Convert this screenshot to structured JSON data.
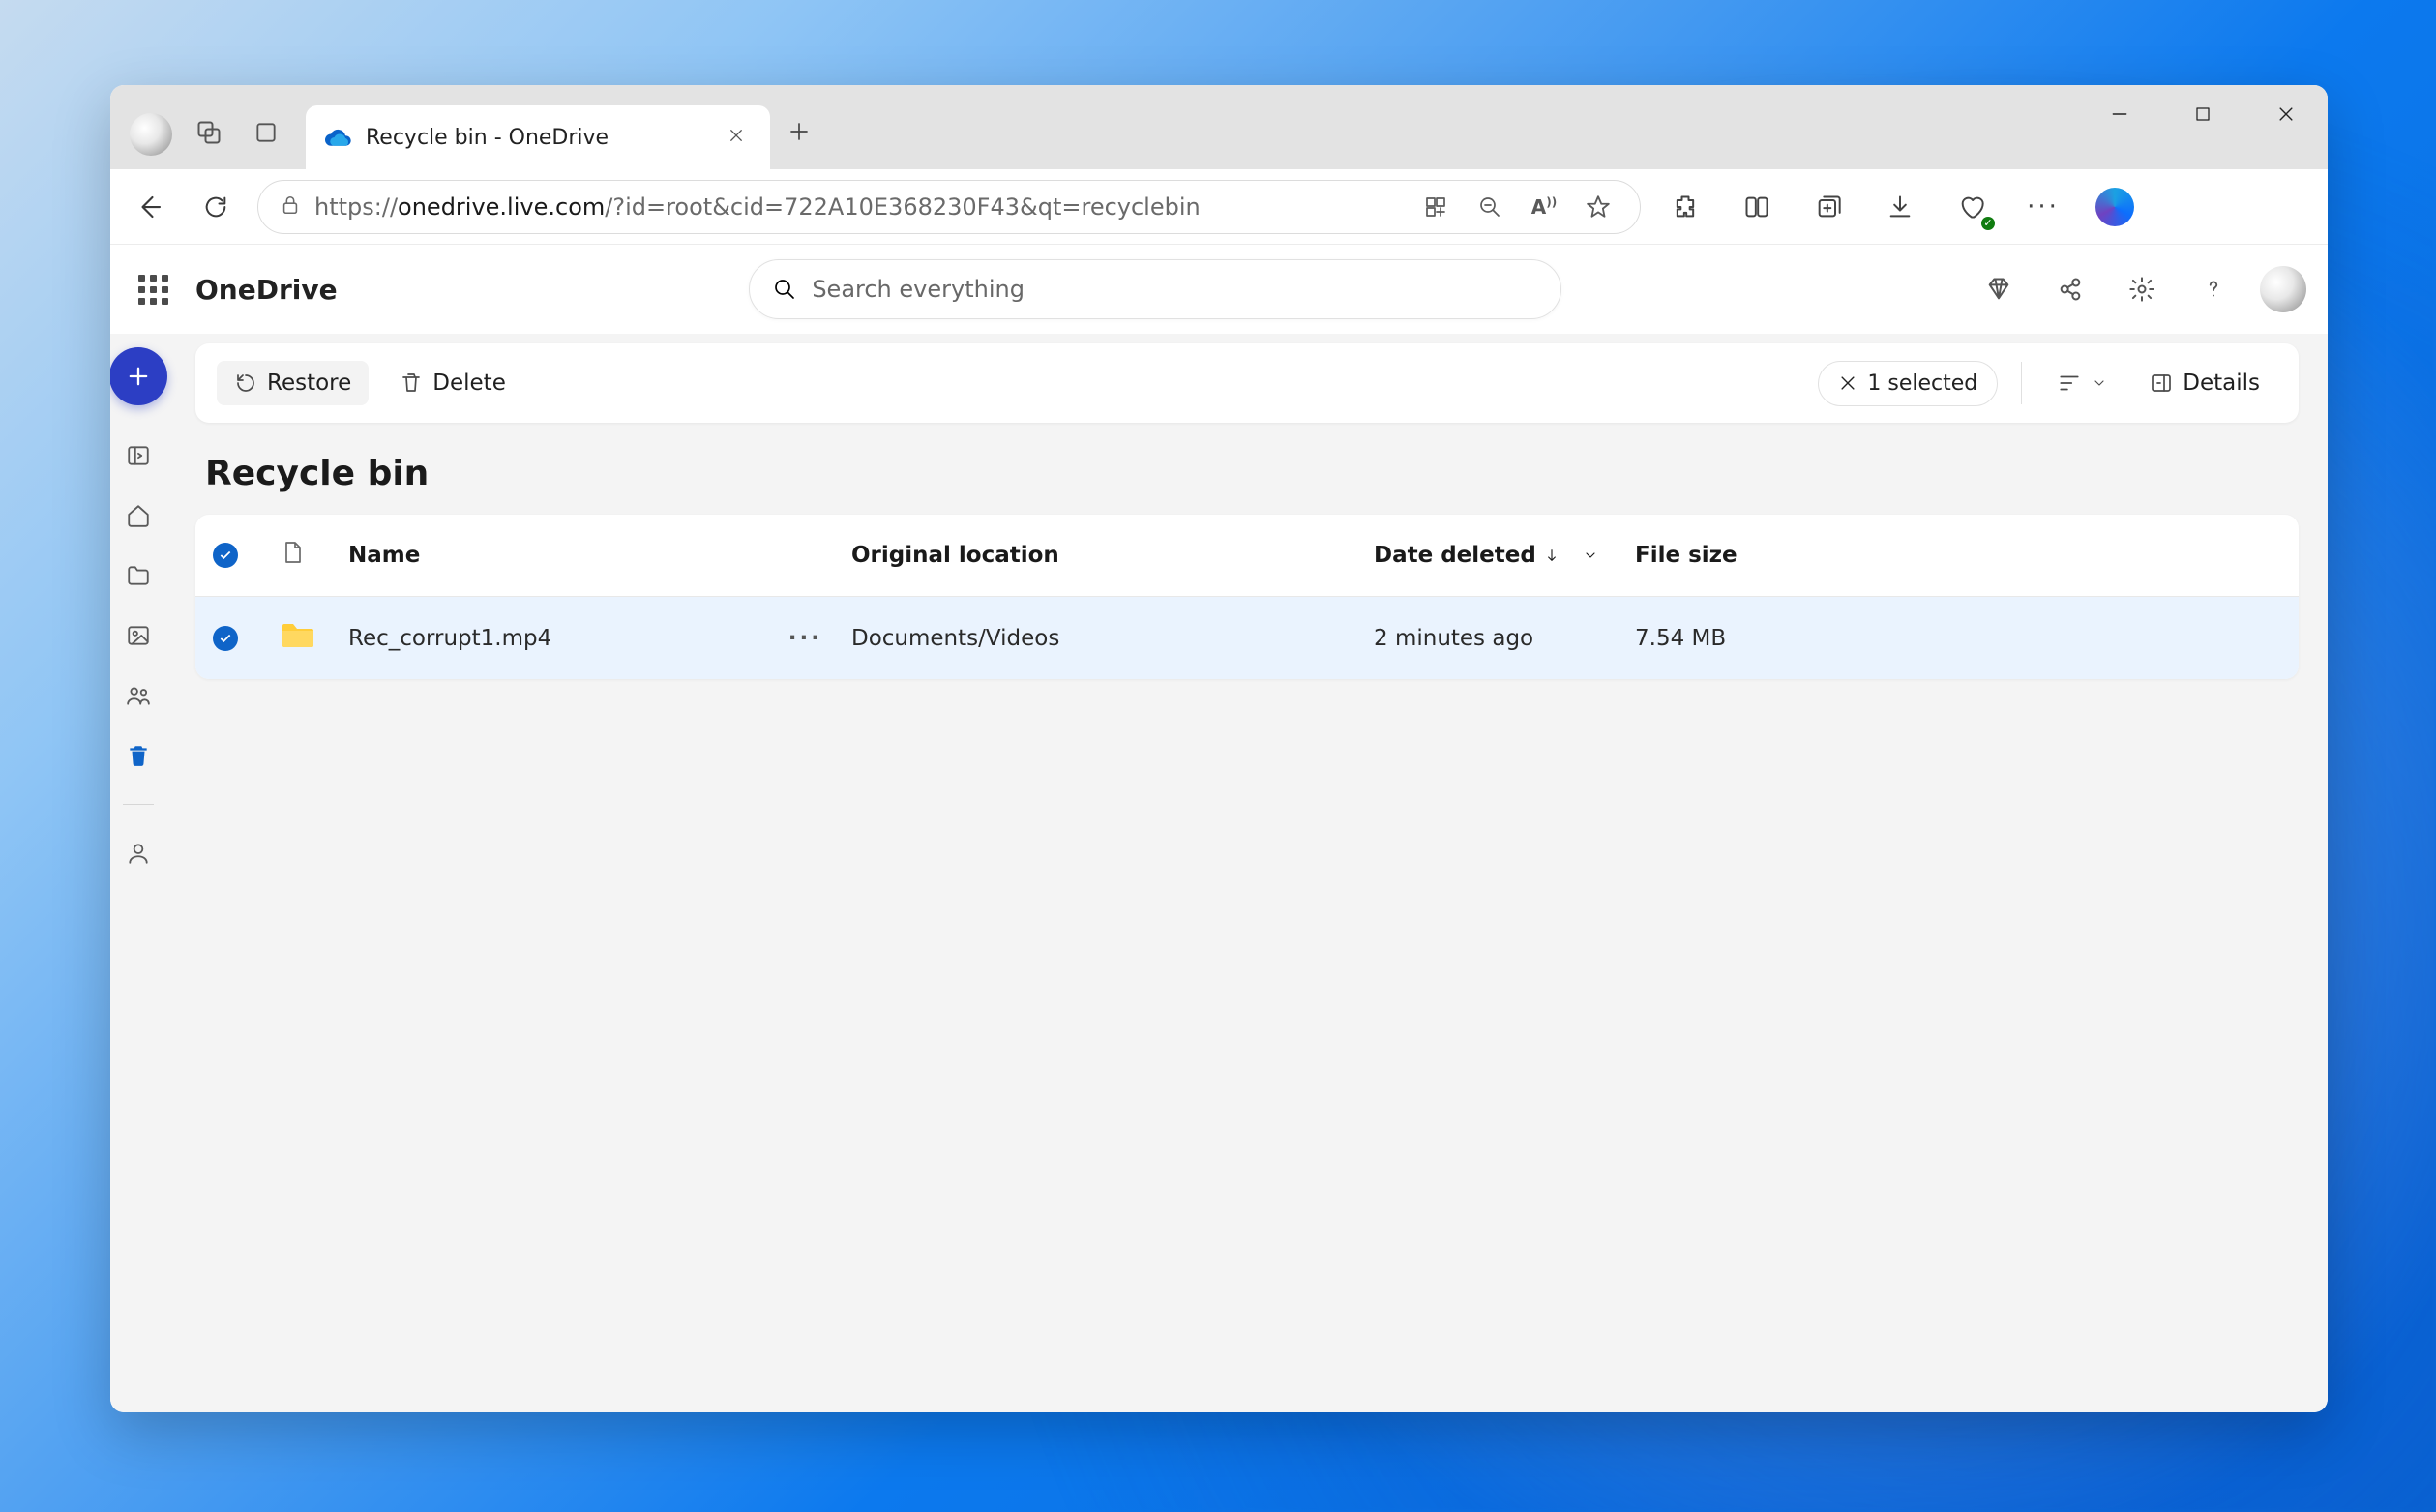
{
  "browser": {
    "tab_title": "Recycle bin - OneDrive",
    "url_prefix": "https://",
    "url_host": "onedrive.live.com",
    "url_path": "/?id=root&cid=722A10E368230F43&qt=recyclebin"
  },
  "app": {
    "brand": "OneDrive",
    "search_placeholder": "Search everything"
  },
  "toolbar": {
    "restore": "Restore",
    "delete": "Delete",
    "selected": "1 selected",
    "details": "Details"
  },
  "page": {
    "title": "Recycle bin"
  },
  "columns": {
    "name": "Name",
    "orig": "Original location",
    "date": "Date deleted",
    "size": "File size"
  },
  "rows": [
    {
      "name": "Rec_corrupt1.mp4",
      "orig": "Documents/Videos",
      "date": "2 minutes ago",
      "size": "7.54 MB",
      "selected": true
    }
  ]
}
